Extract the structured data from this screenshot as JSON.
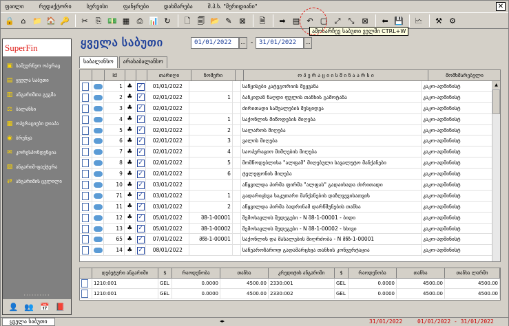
{
  "menu": {
    "items": [
      "ფაილი",
      "რედაქტორი",
      "სერვისი",
      "ფანჯრები",
      "დახმარება",
      "შ.პ.ს. \"მერიდიანი\""
    ]
  },
  "toolbar": {
    "tooltip": "ამოსარჩევ საბუთი ველში  CTRL+W"
  },
  "sidebar": {
    "logo": "SuperFin",
    "items": [
      {
        "label": "სამეურნეო ოპერაც",
        "icon": "folder-icon"
      },
      {
        "label": "ყველა საბუთი",
        "icon": "documents-icon"
      },
      {
        "label": "ანგარიშთა გეგმა",
        "icon": "chart-of-accounts-icon"
      },
      {
        "label": "ბალანსი",
        "icon": "balance-icon"
      },
      {
        "label": "ოპერაციები დიაპა",
        "icon": "operations-icon"
      },
      {
        "label": "ბრუნვა",
        "icon": "turnover-icon"
      },
      {
        "label": "კორესპონდენცია",
        "icon": "correspondence-icon"
      },
      {
        "label": "ანგარიშ-ფაქტურა",
        "icon": "invoice-icon"
      },
      {
        "label": "ანგარიშის ცვლილი",
        "icon": "account-change-icon"
      }
    ],
    "dots": "··········"
  },
  "main": {
    "title": "ყველა საბუთი",
    "date_from": "01/01/2022",
    "date_to": "31/01/2022",
    "date_btn": "...",
    "date_sep": "-",
    "tabs": [
      "საბალანსო",
      "არასაბალანსო"
    ]
  },
  "grid": {
    "columns": [
      "",
      "",
      "id",
      "",
      "",
      "თარიღი",
      "ნომერი",
      "",
      "ო პ ე რ ა ც ი ი ს   შ ი ნ ა ა რ ს ი",
      "მომხმარებელი"
    ],
    "rows": [
      {
        "id": "1",
        "date": "01/01/2022",
        "num": "",
        "desc": "საწყისები კატეგორიის შეყვანა",
        "user": "კაკო-ადმინისტ"
      },
      {
        "id": "2",
        "date": "02/01/2022",
        "num": "1",
        "desc": "ბანკიდან ნაღდი ფულის თანხის გამოტანა",
        "user": "კაკო-ადმინისტ"
      },
      {
        "id": "3",
        "date": "02/01/2022",
        "num": "",
        "desc": "ძირითადი საშუალების შესყიდვა",
        "user": "კაკო-ადმინისტ"
      },
      {
        "id": "4",
        "date": "02/01/2022",
        "num": "1",
        "desc": "საქონლის მიწოდების მიღება",
        "user": "კაკო-ადმინისტ"
      },
      {
        "id": "5",
        "date": "02/01/2022",
        "num": "2",
        "desc": "სალაროს მიღება",
        "user": "კაკო-ადმინისტ"
      },
      {
        "id": "6",
        "date": "02/01/2022",
        "num": "3",
        "desc": "ვალის მიღება",
        "user": "კაკო-ადმინისტ"
      },
      {
        "id": "7",
        "date": "02/01/2022",
        "num": "4",
        "desc": "საოპერაციო მიმღების მიღება",
        "user": "კაკო-ადმინისტ"
      },
      {
        "id": "8",
        "date": "02/01/2022",
        "num": "5",
        "desc": "მომწოდებლისა \"ალფამ\" მიღებული სავალუტო მანქანები",
        "user": "კაკო-ადმინისტ"
      },
      {
        "id": "9",
        "date": "02/01/2022",
        "num": "6",
        "desc": "ტელეფონის მიღება",
        "user": "კაკო-ადმინისტ"
      },
      {
        "id": "10",
        "date": "03/01/2022",
        "num": "",
        "desc": "აწყვილდა პირმა ფირმა \"ალფას\" გადაიხადა ძირითადი",
        "user": "კაკო-ადმინისტ"
      },
      {
        "id": "71",
        "date": "03/01/2022",
        "num": "1",
        "desc": "გადარიცხვა საკუთარი მანქანების დაზღვევისათვის",
        "user": "კაკო-ადმინისტ"
      },
      {
        "id": "11",
        "date": "03/01/2022",
        "num": "2",
        "desc": "აწყვილდა პირმა ბადრინამ დარწმუნების თანხა",
        "user": "კაკო-ადმინისტ"
      },
      {
        "id": "12",
        "date": "05/01/2022",
        "num": "შ8-1-00001",
        "desc": "შემოსავლის შედეგები - N შ8-1-00001 - ბიდი",
        "user": "კაკო-ადმინისტ"
      },
      {
        "id": "13",
        "date": "05/01/2022",
        "num": "შ8-1-00002",
        "desc": "შემოსავლის შედეგები - N შ8-1-00002 - სხივი",
        "user": "კაკო-ადმინისტ"
      },
      {
        "id": "65",
        "date": "07/01/2022",
        "num": "მწზ-1-00001",
        "desc": "საქონლის და მასალების მიღრძობა - N მწზ-1-00001",
        "user": "კაკო-ადმინისტ"
      },
      {
        "id": "14",
        "date": "08/01/2022",
        "num": "",
        "desc": "საწეაროზაროდ გადამარცხვა თანხის კონვერტაცია",
        "user": "კაკო-ადმინისტ"
      }
    ]
  },
  "detail": {
    "columns": [
      "",
      "დებეტური ანგარიში",
      "$",
      "რაოდენობა",
      "თანხა",
      "კრედიტის ანგარიში",
      "$",
      "რაოდენობა",
      "თანხა",
      "თანხა ლარში"
    ],
    "rows": [
      {
        "debit": "1210:001",
        "cur1": "GEL",
        "qty1": "0.0000",
        "amt1": "4500.00",
        "credit": "2330:001",
        "cur2": "GEL",
        "qty2": "0.0000",
        "amt2": "4500.00",
        "gel": "4500.00"
      },
      {
        "debit": "1210:001",
        "cur1": "GEL",
        "qty1": "0.0000",
        "amt1": "4500.00",
        "credit": "2330:002",
        "cur2": "GEL",
        "qty2": "0.0000",
        "amt2": "4500.00",
        "gel": "4500.00"
      }
    ]
  },
  "status": {
    "tab": "ყველა საბუთი",
    "nav": "◂▸",
    "date1": "31/01/2022",
    "date2": "01/01/2022 - 31/01/2022"
  }
}
